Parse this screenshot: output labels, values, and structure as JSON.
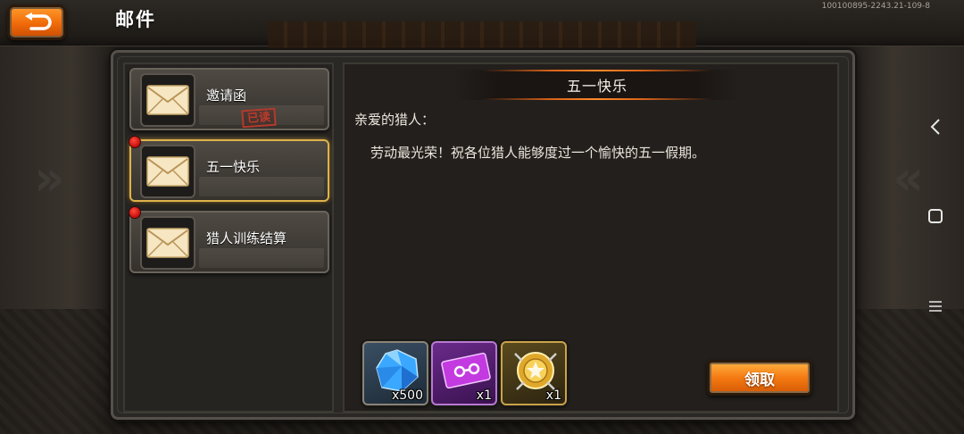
{
  "app": {
    "title": "邮件",
    "version": "100100895-2243.21-109-8"
  },
  "mail_list": [
    {
      "label": "邀请函",
      "stamp": "已读",
      "unread": false,
      "selected": false
    },
    {
      "label": "五一快乐",
      "stamp": "",
      "unread": true,
      "selected": true
    },
    {
      "label": "猎人训练结算",
      "stamp": "",
      "unread": true,
      "selected": false
    }
  ],
  "mail_detail": {
    "title": "五一快乐",
    "greeting": "亲爱的猎人：",
    "body": "劳动最光荣！祝各位猎人能够度过一个愉快的五一假期。",
    "rewards": [
      {
        "icon": "blue-gem-icon",
        "quantity": "x500"
      },
      {
        "icon": "purple-ticket-icon",
        "quantity": "x1"
      },
      {
        "icon": "gold-medal-icon",
        "quantity": "x1"
      }
    ],
    "claim_label": "领取"
  },
  "colors": {
    "accent_orange": "#f47a12",
    "unread_dot": "#e01010",
    "selected_border": "#e0b24a",
    "read_stamp": "#c0392b"
  },
  "nav_icons": [
    "back-icon",
    "home-icon",
    "menu-icon"
  ]
}
